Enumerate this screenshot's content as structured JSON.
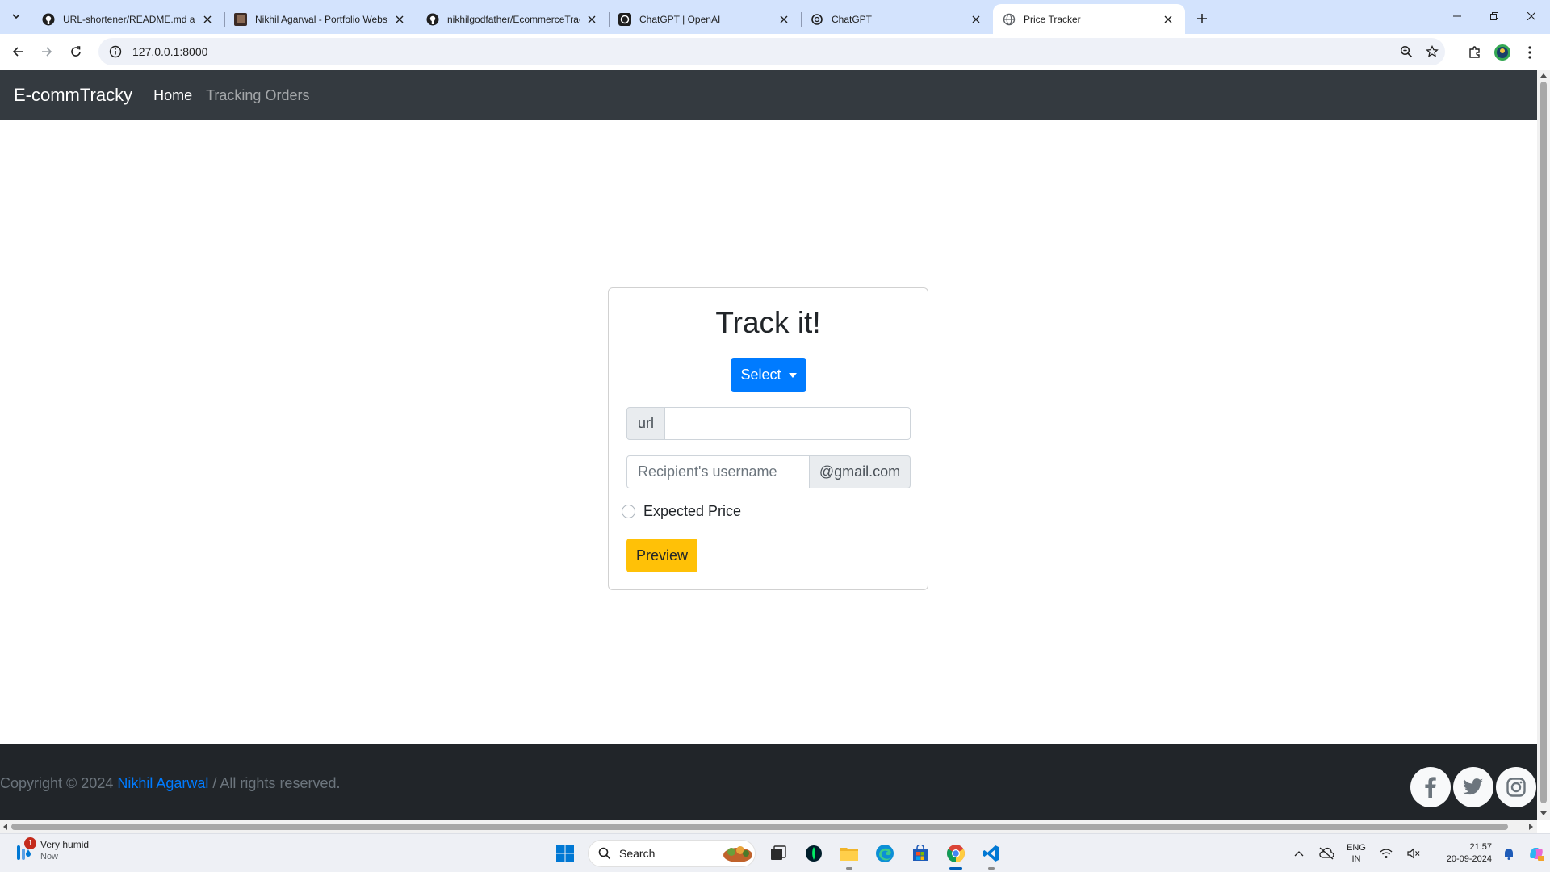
{
  "browser": {
    "tabs": [
      {
        "title": "URL-shortener/README.md at ·",
        "favicon": "github-icon",
        "active": false
      },
      {
        "title": "Nikhil Agarwal - Portfolio Webs",
        "favicon": "portfolio-favicon",
        "active": false
      },
      {
        "title": "nikhilgodfather/EcommerceTrac",
        "favicon": "github-icon",
        "active": false
      },
      {
        "title": "ChatGPT | OpenAI",
        "favicon": "openai-icon",
        "active": false
      },
      {
        "title": "ChatGPT",
        "favicon": "openai-icon",
        "active": false
      },
      {
        "title": "Price Tracker",
        "favicon": "globe-icon",
        "active": true
      }
    ],
    "address": "127.0.0.1:8000"
  },
  "navbar": {
    "brand": "E-commTracky",
    "links": [
      "Home",
      "Tracking Orders"
    ],
    "active_link": "Home"
  },
  "form": {
    "title": "Track it!",
    "select_label": "Select",
    "url_addon": "url",
    "url_value": "",
    "email_placeholder": "Recipient's username",
    "email_suffix": "@gmail.com",
    "expected_price_label": "Expected Price",
    "preview_label": "Preview"
  },
  "footer": {
    "copyright_prefix": "Copyright © 2024 ",
    "owner": "Nikhil Agarwal",
    "copyright_suffix": " / All rights reserved.",
    "social": [
      "facebook-icon",
      "twitter-icon",
      "instagram-icon"
    ]
  },
  "taskbar": {
    "weather_text": "Very humid",
    "weather_time": "Now",
    "notification_count": "1",
    "search_label": "Search",
    "lang_line1": "ENG",
    "lang_line2": "IN",
    "time": "21:57",
    "date": "20-09-2024"
  },
  "colors": {
    "navbar": "#343a40",
    "primary": "#007bff",
    "warning": "#ffc107",
    "footer": "#212529"
  }
}
